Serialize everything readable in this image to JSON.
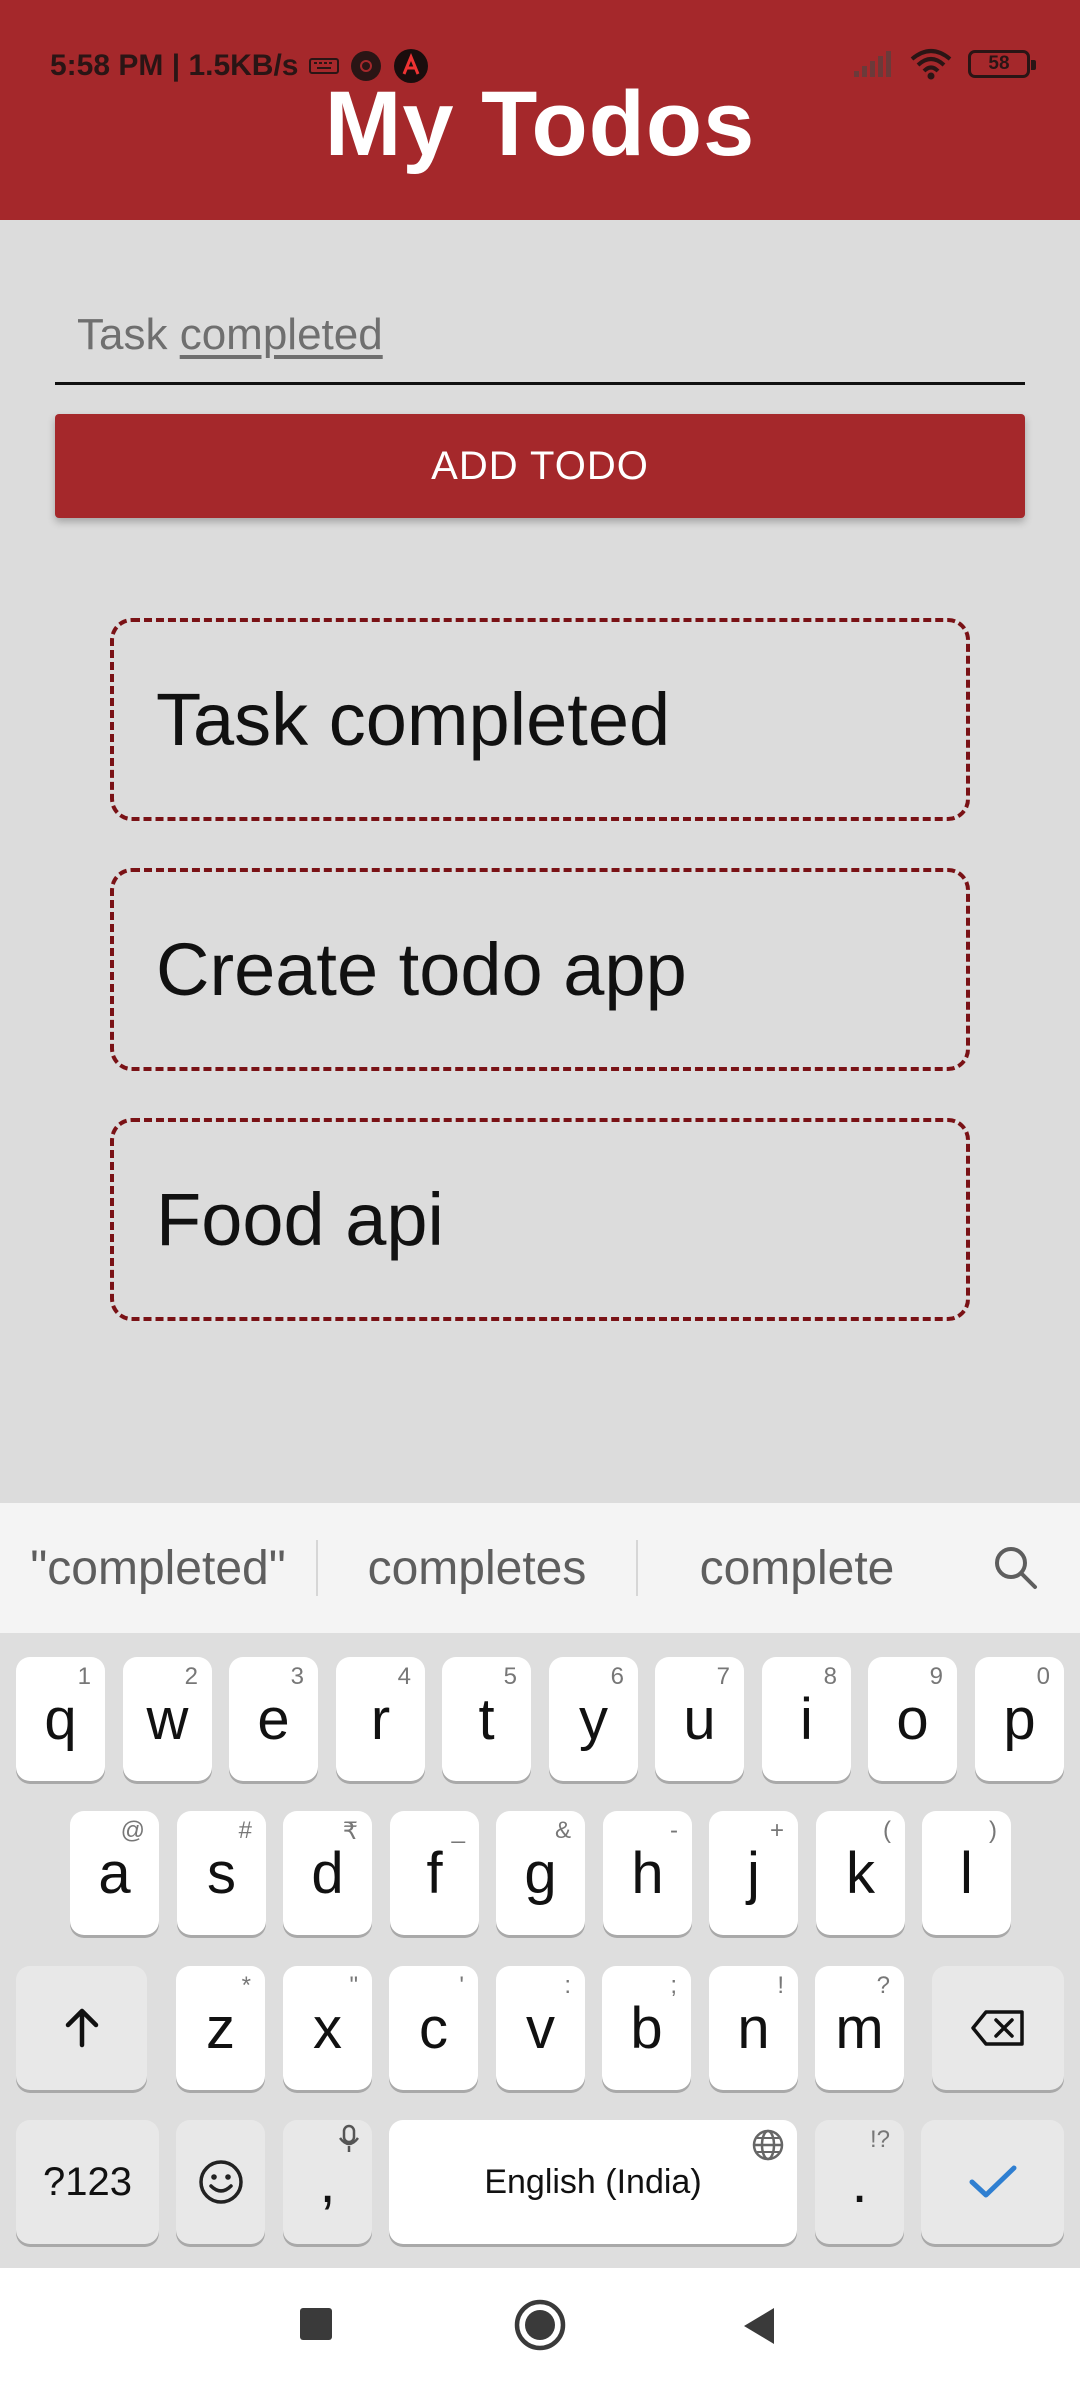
{
  "status_bar": {
    "time": "5:58 PM | 1.5KB/s",
    "battery": "58"
  },
  "header": {
    "title": "My Todos"
  },
  "input": {
    "value_plain": "Task ",
    "value_underlined": "completed"
  },
  "add_button": {
    "label": "ADD TODO"
  },
  "todos": [
    {
      "text": "Task completed"
    },
    {
      "text": "Create todo app"
    },
    {
      "text": "Food api"
    }
  ],
  "suggestions": [
    "\"completed\"",
    "completes",
    "complete"
  ],
  "keyboard": {
    "row1": [
      {
        "k": "q",
        "h": "1"
      },
      {
        "k": "w",
        "h": "2"
      },
      {
        "k": "e",
        "h": "3"
      },
      {
        "k": "r",
        "h": "4"
      },
      {
        "k": "t",
        "h": "5"
      },
      {
        "k": "y",
        "h": "6"
      },
      {
        "k": "u",
        "h": "7"
      },
      {
        "k": "i",
        "h": "8"
      },
      {
        "k": "o",
        "h": "9"
      },
      {
        "k": "p",
        "h": "0"
      }
    ],
    "row2": [
      {
        "k": "a",
        "h": "@"
      },
      {
        "k": "s",
        "h": "#"
      },
      {
        "k": "d",
        "h": "₹"
      },
      {
        "k": "f",
        "h": "_"
      },
      {
        "k": "g",
        "h": "&"
      },
      {
        "k": "h",
        "h": "-"
      },
      {
        "k": "j",
        "h": "+"
      },
      {
        "k": "k",
        "h": "("
      },
      {
        "k": "l",
        "h": ")"
      }
    ],
    "row3": [
      {
        "k": "z",
        "h": "*"
      },
      {
        "k": "x",
        "h": "\""
      },
      {
        "k": "c",
        "h": "'"
      },
      {
        "k": "v",
        "h": ":"
      },
      {
        "k": "b",
        "h": ";"
      },
      {
        "k": "n",
        "h": "!"
      },
      {
        "k": "m",
        "h": "?"
      }
    ],
    "symbols_key": "?123",
    "comma_key": ",",
    "space_label": "English (India)",
    "period_key": ".",
    "period_hint": "!?"
  },
  "colors": {
    "brand_red": "#a5282b",
    "dashed_border": "#7a1216",
    "background": "#dcdcdc"
  }
}
